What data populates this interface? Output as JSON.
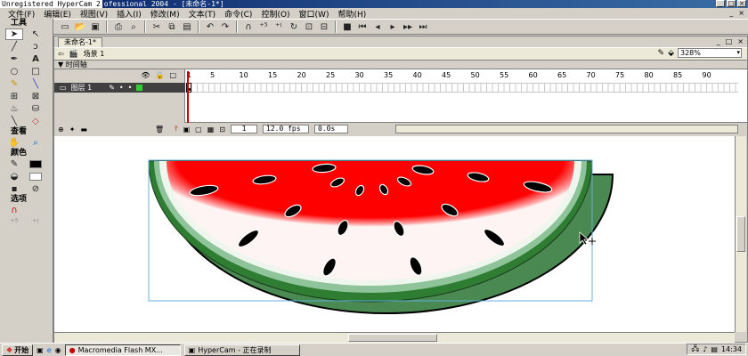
{
  "window": {
    "title_overlay": "Unregistered HyperCam 2",
    "title_rest": "ofessional 2004 - [未命名-1*]",
    "controls": [
      "_",
      "□",
      "×"
    ]
  },
  "menu": {
    "items": [
      "文件(F)",
      "编辑(E)",
      "视图(V)",
      "插入(I)",
      "修改(M)",
      "文本(T)",
      "命令(C)",
      "控制(O)",
      "窗口(W)",
      "帮助(H)"
    ],
    "right_controls": [
      "_",
      "×"
    ]
  },
  "tools": {
    "title": "工具",
    "view_label": "查看",
    "color_label": "颜色",
    "options_label": "选项"
  },
  "document": {
    "tab_label": "未命名-1*",
    "window_controls": [
      "_",
      "□",
      "×"
    ],
    "scene_label": "场景 1",
    "zoom_value": "328%"
  },
  "timeline": {
    "header": "▼ 时间轴",
    "layer_name": "图层 1",
    "ruler": [
      "1",
      "5",
      "10",
      "15",
      "20",
      "25",
      "30",
      "35",
      "40",
      "45",
      "50",
      "55",
      "60",
      "65",
      "70",
      "75",
      "80",
      "85",
      "90"
    ],
    "current_frame": "1",
    "frame_rate": "12.0 fps",
    "elapsed": "0.0s"
  },
  "taskbar": {
    "start_label": "开始",
    "tasks": [
      "Macromedia Flash MX...",
      "HyperCam - 正在录制"
    ],
    "clock": "14:34"
  },
  "colors": {
    "melon_red": "#ff0000",
    "rind_green": "#2e7d32",
    "seed": "#000000"
  }
}
